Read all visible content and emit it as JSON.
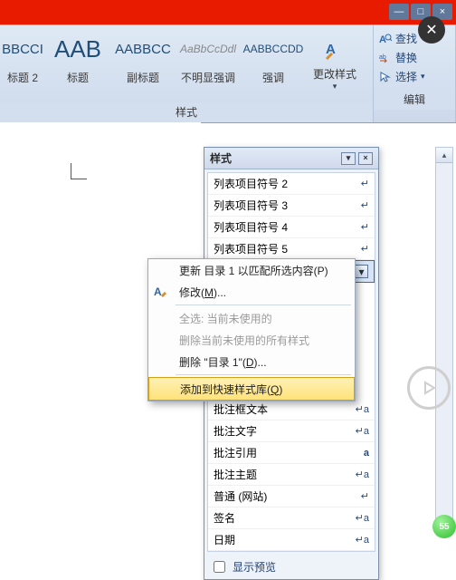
{
  "window": {
    "min": "—",
    "max": "□",
    "close": "×"
  },
  "ribbon": {
    "tiles": [
      {
        "sample": "BBCCI",
        "label": "标题 2",
        "fs": "15px",
        "col": "#23578e"
      },
      {
        "sample": "AAB",
        "label": "标题",
        "fs": "26px",
        "col": "#23578e"
      },
      {
        "sample": "AABBCC",
        "label": "副标题",
        "fs": "15px",
        "col": "#23578e"
      },
      {
        "sample": "AaBbCcDdl",
        "label": "不明显强调",
        "fs": "12px",
        "col": "#7a7a7a",
        "italic": true
      },
      {
        "sample": "AABBCCDD",
        "label": "强调",
        "fs": "12px",
        "col": "#23578e"
      }
    ],
    "changeStyles": "更改样式",
    "groupStyles": "样式",
    "find": "查找",
    "replace": "替换",
    "select": "选择",
    "groupEdit": "编辑"
  },
  "pane": {
    "title": "样式",
    "items": [
      "列表项目符号 2",
      "列表项目符号 3",
      "列表项目符号 4",
      "列表项目符号 5"
    ],
    "selected": "目录 1",
    "rest": [
      "批注框文本",
      "批注文字",
      "批注引用",
      "批注主题",
      "普通 (网站)",
      "签名",
      "日期"
    ],
    "restMarks": [
      "↵a",
      "↵a",
      "a",
      "↵a",
      "↵",
      "↵a",
      "↵a"
    ],
    "showPreview": "显示预览"
  },
  "menu": {
    "update": "更新 目录 1 以匹配所选内容(P)",
    "modify": "修改(M)...",
    "selectAll": "全选: 当前未使用的",
    "deleteAll": "删除当前未使用的所有样式",
    "delete": "删除 \"目录 1\"(D)...",
    "addQuick": "添加到快速样式库(Q)"
  }
}
